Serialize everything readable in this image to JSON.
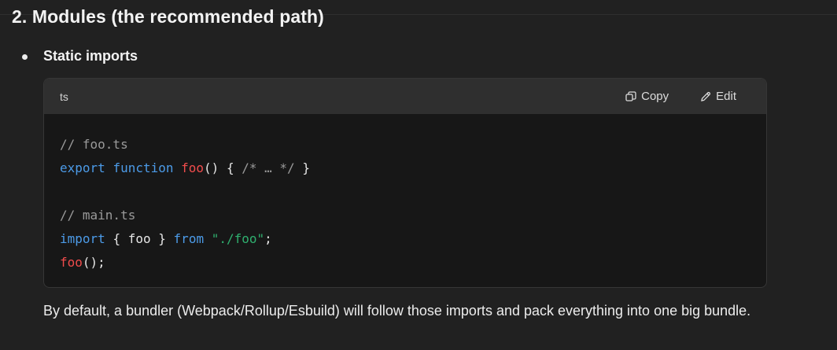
{
  "section": {
    "heading": "2. Modules (the recommended path)"
  },
  "bullet": {
    "label": "Static imports"
  },
  "code_block": {
    "language": "ts",
    "copy_label": "Copy",
    "edit_label": "Edit",
    "lines": {
      "l1": {
        "comment": "// foo.ts"
      },
      "l2": {
        "kw1": "export",
        "kw2": "function",
        "fn": "foo",
        "punct1": "()",
        "punct2": "{",
        "comment": "/* … */",
        "punct3": "}"
      },
      "l4": {
        "comment": "// main.ts"
      },
      "l5": {
        "kw1": "import",
        "punct1": "{",
        "ident": "foo",
        "punct2": "}",
        "kw2": "from",
        "str": "\"./foo\"",
        "punct3": ";"
      },
      "l6": {
        "fn": "foo",
        "punct1": "();"
      }
    }
  },
  "paragraph": {
    "text": "By default, a bundler (Webpack/Rollup/Esbuild) will follow those imports and pack everything into one big bundle."
  },
  "colors": {
    "background": "#212121",
    "code_background": "#171717",
    "code_header": "#2f2f2f",
    "keyword": "#4c9be8",
    "function": "#f14c4c",
    "string": "#2fb06f",
    "comment": "#9a9a9a"
  },
  "icons": {
    "copy": "copy-icon",
    "edit": "pencil-icon"
  }
}
